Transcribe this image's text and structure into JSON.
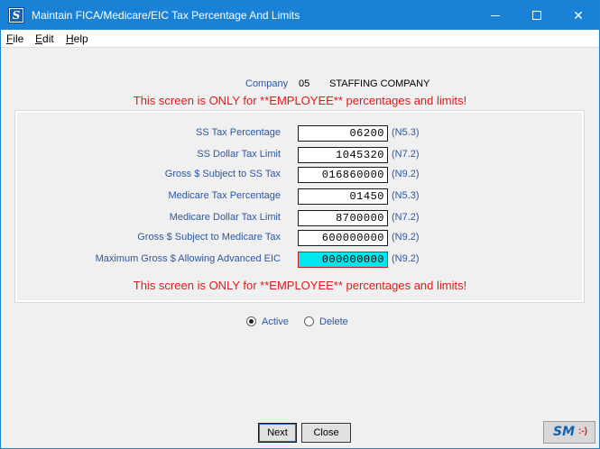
{
  "window": {
    "title": "Maintain FICA/Medicare/EIC Tax Percentage And Limits",
    "minimize_glyph": "",
    "maximize_glyph": "",
    "close_glyph": "✕",
    "app_icon_letter": "S"
  },
  "menu": {
    "file": "File",
    "edit": "Edit",
    "help": "Help"
  },
  "company": {
    "label": "Company",
    "code": "05",
    "name": "STAFFING COMPANY"
  },
  "warning_text": "This screen is ONLY for **EMPLOYEE** percentages and limits!",
  "fields": [
    {
      "label": "SS Tax Percentage",
      "value": "06200",
      "format": "(N5.3)"
    },
    {
      "label": "SS Dollar Tax Limit",
      "value": "1045320",
      "format": "(N7.2)"
    },
    {
      "label": "Gross $ Subject to SS Tax",
      "value": "016860000",
      "format": "(N9.2)"
    },
    {
      "label": "Medicare Tax Percentage",
      "value": "01450",
      "format": "(N5.3)"
    },
    {
      "label": "Medicare Dollar Tax Limit",
      "value": "8700000",
      "format": "(N7.2)"
    },
    {
      "label": "Gross $ Subject to Medicare Tax",
      "value": "600000000",
      "format": "(N9.2)"
    },
    {
      "label": "Maximum Gross $ Allowing Advanced EIC",
      "value": "000000000",
      "format": "(N9.2)"
    }
  ],
  "status": {
    "active_label": "Active",
    "delete_label": "Delete",
    "selected": "Active"
  },
  "buttons": {
    "next": "Next",
    "close": "Close"
  },
  "logo": {
    "text": "SM",
    "smile": ":-)"
  },
  "colors": {
    "titlebar": "#1a82d6",
    "label_blue": "#2d56a0",
    "warning_red": "#e01a1a",
    "active_field": "#00e8ee"
  }
}
